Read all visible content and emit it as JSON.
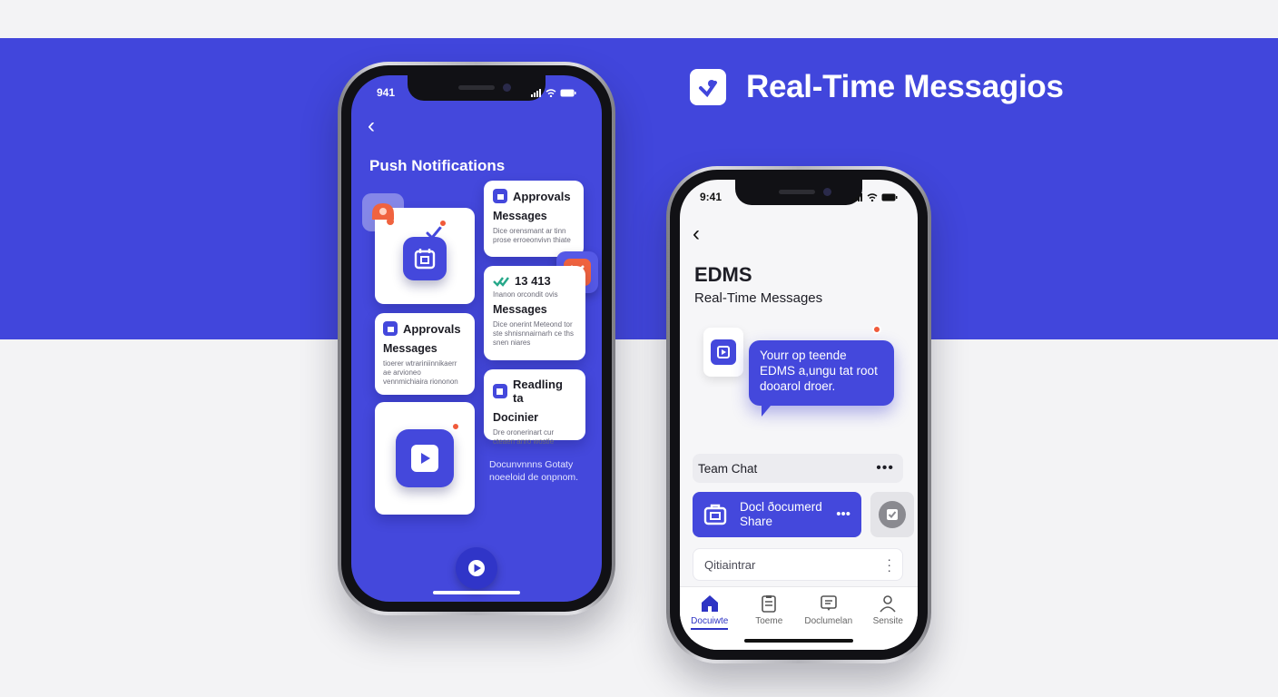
{
  "hero": {
    "title": "Real-Time Messagios"
  },
  "colors": {
    "brand": "#4146dc",
    "accent": "#f05a3a",
    "surface": "#ffffff"
  },
  "left_phone": {
    "time": "941",
    "title": "Push Notifications",
    "cards": {
      "approvals_top": {
        "title": "Approvals",
        "subtitle": "Messages",
        "body": "Dice orensmant ar tinn prose erroeonvivn thiate"
      },
      "count": {
        "title": "13 413",
        "note": "Inanon orcondit ovis",
        "subtitle": "Messages",
        "body": "Dice onerint Meteond tor ste shnisnnairnarh ce ths snen niares"
      },
      "approvals_left": {
        "title": "Approvals",
        "subtitle": "Messages",
        "body": "tioerer wtrariniinnikaerr ae arvioneo vennmichiaira riononon"
      },
      "readling": {
        "title": "Readling ta",
        "subtitle": "Docinier",
        "body": "Dre oronerinart cur cteaen anro wostle"
      }
    },
    "caption": {
      "line1": "Docunvnnns Gotaty",
      "line2": "noeeloid de onpnom."
    }
  },
  "right_phone": {
    "time": "9:41",
    "title": "EDMS",
    "subtitle": "Real-Time Messages",
    "bubble": {
      "line1": "Yourr op teende",
      "line2": "EDMS a,ungu tat root",
      "line3": "dooarol droer."
    },
    "team_chat": "Team Chat",
    "share": {
      "line1": "Docl ðocumerd",
      "line2": "Share"
    },
    "search": "Qitiaintrar",
    "tabs": [
      {
        "label": "Docuiwte",
        "icon": "home-icon",
        "active": true
      },
      {
        "label": "Toeme",
        "icon": "document-icon",
        "active": false
      },
      {
        "label": "Doclumelan",
        "icon": "message-icon",
        "active": false
      },
      {
        "label": "Sensite",
        "icon": "person-icon",
        "active": false
      }
    ]
  }
}
